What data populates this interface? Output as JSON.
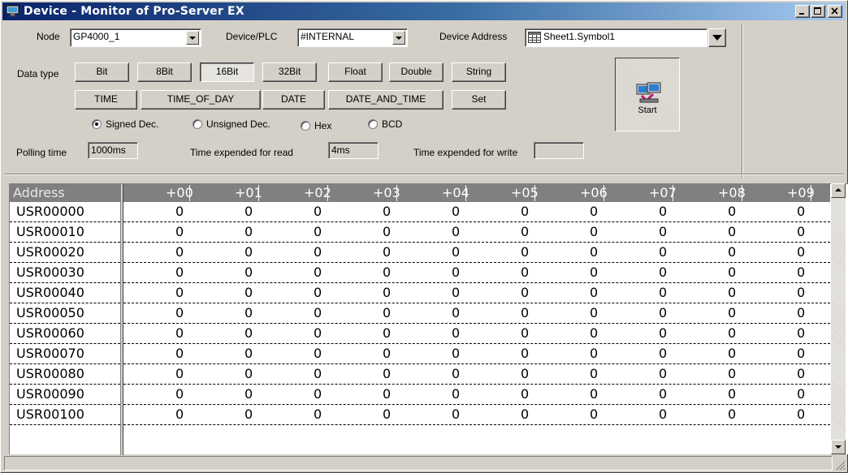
{
  "window": {
    "title": "Device - Monitor of Pro-Server EX",
    "icons": {
      "app": "monitor-app-icon",
      "minimize": "minimize-icon",
      "maximize": "maximize-icon",
      "close": "close-icon"
    }
  },
  "node": {
    "label": "Node",
    "value": "GP4000_1"
  },
  "device_plc": {
    "label": "Device/PLC",
    "value": "#INTERNAL"
  },
  "device_address": {
    "label": "Device Address",
    "value": "Sheet1.Symbol1",
    "icon": "symbol-sheet-icon"
  },
  "data_type": {
    "label": "Data type",
    "row1": [
      "Bit",
      "8Bit",
      "16Bit",
      "32Bit",
      "Float",
      "Double",
      "String"
    ],
    "row2": [
      "TIME",
      "TIME_OF_DAY",
      "DATE",
      "DATE_AND_TIME",
      "Set"
    ],
    "selected": "16Bit"
  },
  "format": {
    "options": [
      "Signed Dec.",
      "Unsigned Dec.",
      "Hex",
      "BCD"
    ],
    "selected": "Signed Dec."
  },
  "polling": {
    "label": "Polling time",
    "value": "1000ms"
  },
  "read_time": {
    "label": "Time expended for read",
    "value": "4ms"
  },
  "write_time": {
    "label": "Time expended for write",
    "value": ""
  },
  "start": {
    "label": "Start",
    "icon": "start-monitor-icon"
  },
  "grid": {
    "address_header": "Address",
    "columns": [
      "+00",
      "+01",
      "+02",
      "+03",
      "+04",
      "+05",
      "+06",
      "+07",
      "+08",
      "+09"
    ],
    "rows": [
      {
        "address": "USR00000",
        "values": [
          "0",
          "0",
          "0",
          "0",
          "0",
          "0",
          "0",
          "0",
          "0",
          "0"
        ]
      },
      {
        "address": "USR00010",
        "values": [
          "0",
          "0",
          "0",
          "0",
          "0",
          "0",
          "0",
          "0",
          "0",
          "0"
        ]
      },
      {
        "address": "USR00020",
        "values": [
          "0",
          "0",
          "0",
          "0",
          "0",
          "0",
          "0",
          "0",
          "0",
          "0"
        ]
      },
      {
        "address": "USR00030",
        "values": [
          "0",
          "0",
          "0",
          "0",
          "0",
          "0",
          "0",
          "0",
          "0",
          "0"
        ]
      },
      {
        "address": "USR00040",
        "values": [
          "0",
          "0",
          "0",
          "0",
          "0",
          "0",
          "0",
          "0",
          "0",
          "0"
        ]
      },
      {
        "address": "USR00050",
        "values": [
          "0",
          "0",
          "0",
          "0",
          "0",
          "0",
          "0",
          "0",
          "0",
          "0"
        ]
      },
      {
        "address": "USR00060",
        "values": [
          "0",
          "0",
          "0",
          "0",
          "0",
          "0",
          "0",
          "0",
          "0",
          "0"
        ]
      },
      {
        "address": "USR00070",
        "values": [
          "0",
          "0",
          "0",
          "0",
          "0",
          "0",
          "0",
          "0",
          "0",
          "0"
        ]
      },
      {
        "address": "USR00080",
        "values": [
          "0",
          "0",
          "0",
          "0",
          "0",
          "0",
          "0",
          "0",
          "0",
          "0"
        ]
      },
      {
        "address": "USR00090",
        "values": [
          "0",
          "0",
          "0",
          "0",
          "0",
          "0",
          "0",
          "0",
          "0",
          "0"
        ]
      },
      {
        "address": "USR00100",
        "values": [
          "0",
          "0",
          "0",
          "0",
          "0",
          "0",
          "0",
          "0",
          "0",
          "0"
        ]
      }
    ]
  },
  "status": {
    "text": ""
  }
}
